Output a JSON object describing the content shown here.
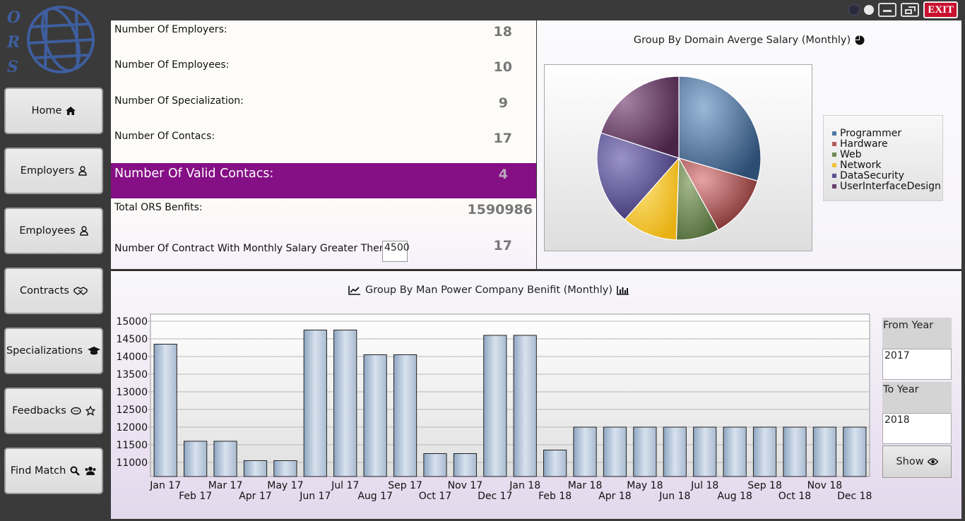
{
  "window": {
    "exit_label": "EXIT"
  },
  "logo": {
    "letters": [
      "O",
      "R",
      "S"
    ]
  },
  "sidebar": {
    "items": [
      {
        "label": "Home",
        "icon": "home-icon"
      },
      {
        "label": "Employers",
        "icon": "user-icon"
      },
      {
        "label": "Employees",
        "icon": "user-icon"
      },
      {
        "label": "Contracts",
        "icon": "handshake-icon"
      },
      {
        "label": "Specializations",
        "icon": "graduation-cap-icon"
      },
      {
        "label": "Feedbacks",
        "icon": "comment-star-icon"
      },
      {
        "label": "Find Match",
        "icon": "search-users-icon"
      }
    ]
  },
  "stats": {
    "employers_label": "Number Of Employers:",
    "employers_value": "18",
    "employees_label": "Number Of Employees:",
    "employees_value": "10",
    "specialization_label": "Number Of Specialization:",
    "specialization_value": "9",
    "contacs_label": "Number Of Contacs:",
    "contacs_value": "17",
    "valid_contacs_label": "Number Of Valid Contacs:",
    "valid_contacs_value": "4",
    "total_benefits_label": "Total ORS Benfits:",
    "total_benefits_value": "1590986",
    "salary_filter_label": "Number Of Contract With Monthly Salary Greater Then:",
    "salary_filter_input": "4500",
    "salary_filter_value": "17"
  },
  "pie": {
    "title": "Group By Domain Averge Salary (Monthly)",
    "legend": [
      "Programmer",
      "Hardware",
      "Web",
      "Network",
      "DataSecurity",
      "UserInterfaceDesign"
    ]
  },
  "bar": {
    "title": "Group By Man Power Company  Benifit (Monthly)"
  },
  "year_filter": {
    "from_label": "From Year",
    "from_value": "2017",
    "to_label": "To Year",
    "to_value": "2018",
    "show_label": "Show"
  },
  "colors": {
    "highlight": "#850f85",
    "programmer": "#4f79a8",
    "hardware": "#b55a5a",
    "web": "#6d8a52",
    "network": "#f2c23a",
    "datasecurity": "#5a5194",
    "userinterfacedesign": "#6a3d6a"
  },
  "chart_data": [
    {
      "type": "pie",
      "title": "Group By Domain Averge Salary (Monthly)",
      "categories": [
        "Programmer",
        "Hardware",
        "Web",
        "Network",
        "DataSecurity",
        "UserInterfaceDesign"
      ],
      "values": [
        29.5,
        12.5,
        8.5,
        11.0,
        18.5,
        20.0
      ],
      "legend": "right"
    },
    {
      "type": "bar",
      "title": "Group By Man Power Company  Benifit (Monthly)",
      "categories": [
        "Jan 17",
        "Feb 17",
        "Mar 17",
        "Apr 17",
        "May 17",
        "Jun 17",
        "Jul 17",
        "Aug 17",
        "Sep 17",
        "Oct 17",
        "Nov 17",
        "Dec 17",
        "Jan 18",
        "Feb 18",
        "Mar 18",
        "Apr 18",
        "May 18",
        "Jun 18",
        "Jul 18",
        "Aug 18",
        "Sep 18",
        "Oct 18",
        "Nov 18",
        "Dec 18"
      ],
      "values": [
        14350,
        11600,
        11600,
        11050,
        11050,
        14750,
        14750,
        14050,
        14050,
        11250,
        11250,
        14600,
        14600,
        11350,
        12000,
        12000,
        12000,
        12000,
        12000,
        12000,
        12000,
        12000,
        12000,
        12000
      ],
      "yticks": [
        11000,
        11500,
        12000,
        12500,
        13000,
        13500,
        14000,
        14500,
        15000
      ],
      "ylim": [
        10600,
        15200
      ],
      "grid": true
    }
  ]
}
